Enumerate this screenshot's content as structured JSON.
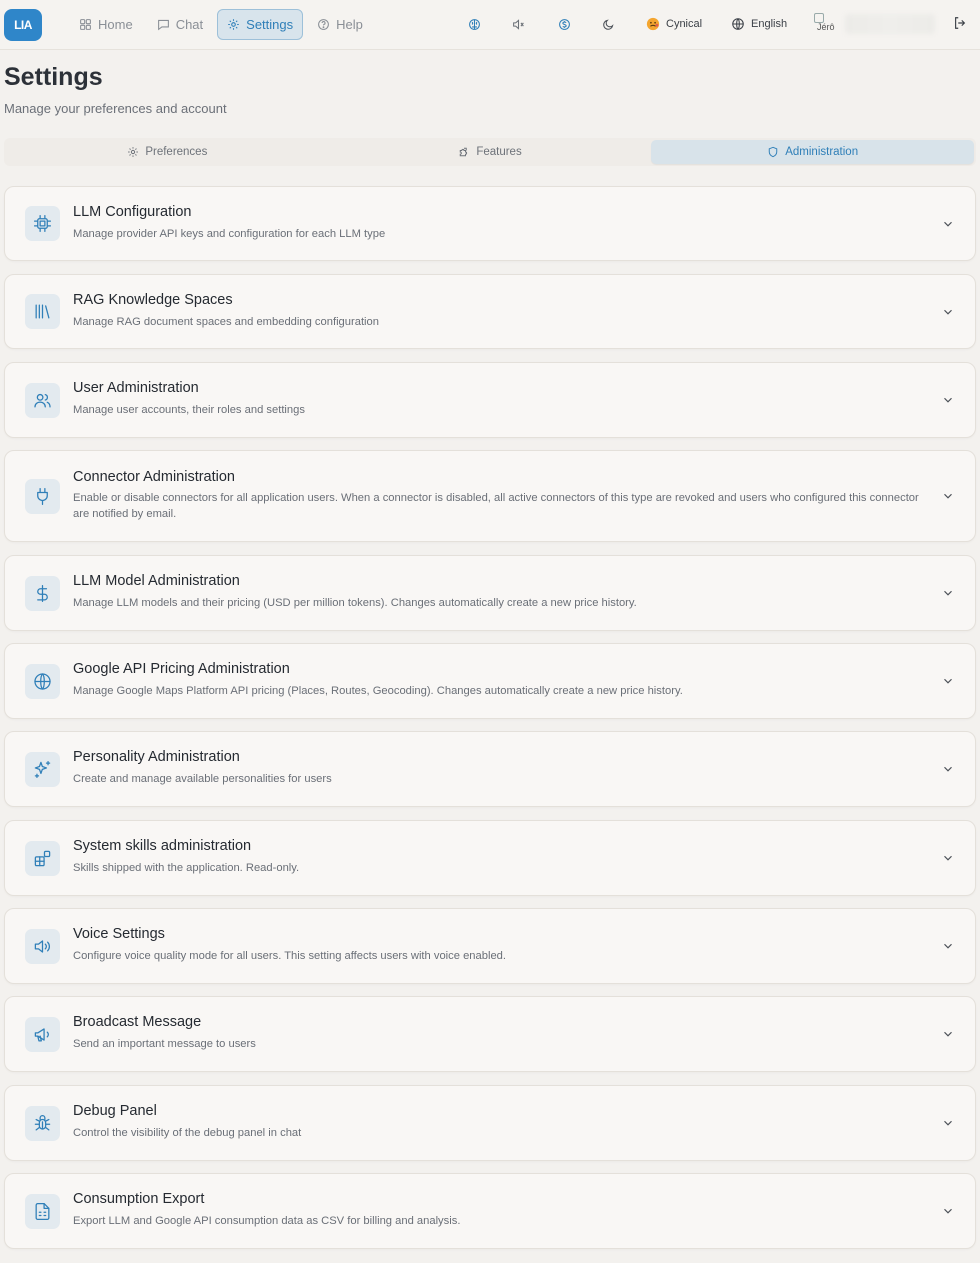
{
  "app": {
    "logo_text": "LIA"
  },
  "nav": [
    {
      "label": "Home",
      "icon": "grid-icon"
    },
    {
      "label": "Chat",
      "icon": "chat-icon"
    },
    {
      "label": "Settings",
      "icon": "gear-icon",
      "active": true
    },
    {
      "label": "Help",
      "icon": "help-icon"
    }
  ],
  "toolbar": {
    "personality_label": "Cynical",
    "language_label": "English",
    "avatar_alt": "Jérô"
  },
  "header": {
    "title": "Settings",
    "subtitle": "Manage your preferences and account"
  },
  "tabs": [
    {
      "label": "Preferences",
      "icon": "gear-icon"
    },
    {
      "label": "Features",
      "icon": "puzzle-icon"
    },
    {
      "label": "Administration",
      "icon": "shield-icon",
      "active": true
    }
  ],
  "sections": [
    {
      "title": "LLM Configuration",
      "description": "Manage provider API keys and configuration for each LLM type",
      "icon": "cpu-icon"
    },
    {
      "title": "RAG Knowledge Spaces",
      "description": "Manage RAG document spaces and embedding configuration",
      "icon": "library-icon"
    },
    {
      "title": "User Administration",
      "description": "Manage user accounts, their roles and settings",
      "icon": "users-icon"
    },
    {
      "title": "Connector Administration",
      "description": "Enable or disable connectors for all application users. When a connector is disabled, all active connectors of this type are revoked and users who configured this connector are notified by email.",
      "icon": "plug-icon"
    },
    {
      "title": "LLM Model Administration",
      "description": "Manage LLM models and their pricing (USD per million tokens). Changes automatically create a new price history.",
      "icon": "dollar-icon"
    },
    {
      "title": "Google API Pricing Administration",
      "description": "Manage Google Maps Platform API pricing (Places, Routes, Geocoding). Changes automatically create a new price history.",
      "icon": "globe-icon"
    },
    {
      "title": "Personality Administration",
      "description": "Create and manage available personalities for users",
      "icon": "sparkles-icon"
    },
    {
      "title": "System skills administration",
      "description": "Skills shipped with the application. Read-only.",
      "icon": "blocks-icon"
    },
    {
      "title": "Voice Settings",
      "description": "Configure voice quality mode for all users. This setting affects users with voice enabled.",
      "icon": "speaker-icon"
    },
    {
      "title": "Broadcast Message",
      "description": "Send an important message to users",
      "icon": "megaphone-icon"
    },
    {
      "title": "Debug Panel",
      "description": "Control the visibility of the debug panel in chat",
      "icon": "bug-icon"
    },
    {
      "title": "Consumption Export",
      "description": "Export LLM and Google API consumption data as CSV for billing and analysis.",
      "icon": "file-sheet-icon"
    }
  ],
  "colors": {
    "accent": "#2f7fb8",
    "logo_bg": "#2f86c9",
    "background": "#f3f1ee"
  }
}
